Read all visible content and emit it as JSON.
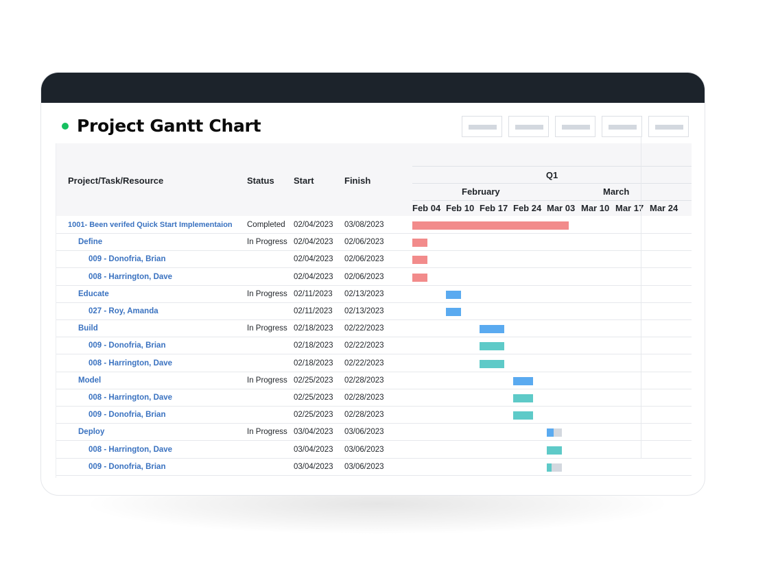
{
  "page": {
    "title": "Project Gantt Chart",
    "status_color": "#16c060"
  },
  "toolbar": {
    "buttons": [
      "",
      "",
      "",
      "",
      ""
    ]
  },
  "columns": {
    "name": "Project/Task/Resource",
    "status": "Status",
    "start": "Start",
    "finish": "Finish"
  },
  "timeline": {
    "quarter": "Q1",
    "months": [
      "February",
      "March"
    ],
    "weeks": [
      "Feb 04",
      "Feb 10",
      "Feb 17",
      "Feb 24",
      "Mar 03",
      "Mar 10",
      "Mar 17",
      "Mar 24"
    ],
    "week_starts": [
      "2023-02-04",
      "2023-02-10",
      "2023-02-17",
      "2023-02-24",
      "2023-03-03",
      "2023-03-10",
      "2023-03-17",
      "2023-03-24"
    ]
  },
  "colors": {
    "project": "#f28b8b",
    "task": "#5aaaf0",
    "resource": "#5ecac8",
    "remaining": "#d3d8df"
  },
  "rows": [
    {
      "name": "1001- Been verifed Quick Start Implementaion",
      "level": 0,
      "status": "Completed",
      "start": "02/04/2023",
      "finish": "03/08/2023",
      "kind": "project",
      "progress": 1
    },
    {
      "name": "Define",
      "level": 1,
      "status": "In Progress",
      "start": "02/04/2023",
      "finish": "02/06/2023",
      "kind": "project",
      "progress": 1
    },
    {
      "name": "009 - Donofria, Brian",
      "level": 2,
      "status": "",
      "start": "02/04/2023",
      "finish": "02/06/2023",
      "kind": "project",
      "progress": 1
    },
    {
      "name": "008 - Harrington, Dave",
      "level": 2,
      "status": "",
      "start": "02/04/2023",
      "finish": "02/06/2023",
      "kind": "project",
      "progress": 1
    },
    {
      "name": "Educate",
      "level": 1,
      "status": "In Progress",
      "start": "02/11/2023",
      "finish": "02/13/2023",
      "kind": "task",
      "progress": 1
    },
    {
      "name": "027 - Roy, Amanda",
      "level": 2,
      "status": "",
      "start": "02/11/2023",
      "finish": "02/13/2023",
      "kind": "task",
      "progress": 1
    },
    {
      "name": "Build",
      "level": 1,
      "status": "In Progress",
      "start": "02/18/2023",
      "finish": "02/22/2023",
      "kind": "task",
      "progress": 1
    },
    {
      "name": "009 - Donofria, Brian",
      "level": 2,
      "status": "",
      "start": "02/18/2023",
      "finish": "02/22/2023",
      "kind": "resource",
      "progress": 1
    },
    {
      "name": "008 - Harrington, Dave",
      "level": 2,
      "status": "",
      "start": "02/18/2023",
      "finish": "02/22/2023",
      "kind": "resource",
      "progress": 1
    },
    {
      "name": "Model",
      "level": 1,
      "status": "In Progress",
      "start": "02/25/2023",
      "finish": "02/28/2023",
      "kind": "task",
      "progress": 1
    },
    {
      "name": "008 - Harrington, Dave",
      "level": 2,
      "status": "",
      "start": "02/25/2023",
      "finish": "02/28/2023",
      "kind": "resource",
      "progress": 1
    },
    {
      "name": "009 - Donofria, Brian",
      "level": 2,
      "status": "",
      "start": "02/25/2023",
      "finish": "02/28/2023",
      "kind": "resource",
      "progress": 1
    },
    {
      "name": "Deploy",
      "level": 1,
      "status": "In Progress",
      "start": "03/04/2023",
      "finish": "03/06/2023",
      "kind": "task",
      "progress": 0.45
    },
    {
      "name": "008 - Harrington, Dave",
      "level": 2,
      "status": "",
      "start": "03/04/2023",
      "finish": "03/06/2023",
      "kind": "resource",
      "progress": 1
    },
    {
      "name": "009 - Donofria, Brian",
      "level": 2,
      "status": "",
      "start": "03/04/2023",
      "finish": "03/06/2023",
      "kind": "resource",
      "progress": 0.3
    }
  ]
}
